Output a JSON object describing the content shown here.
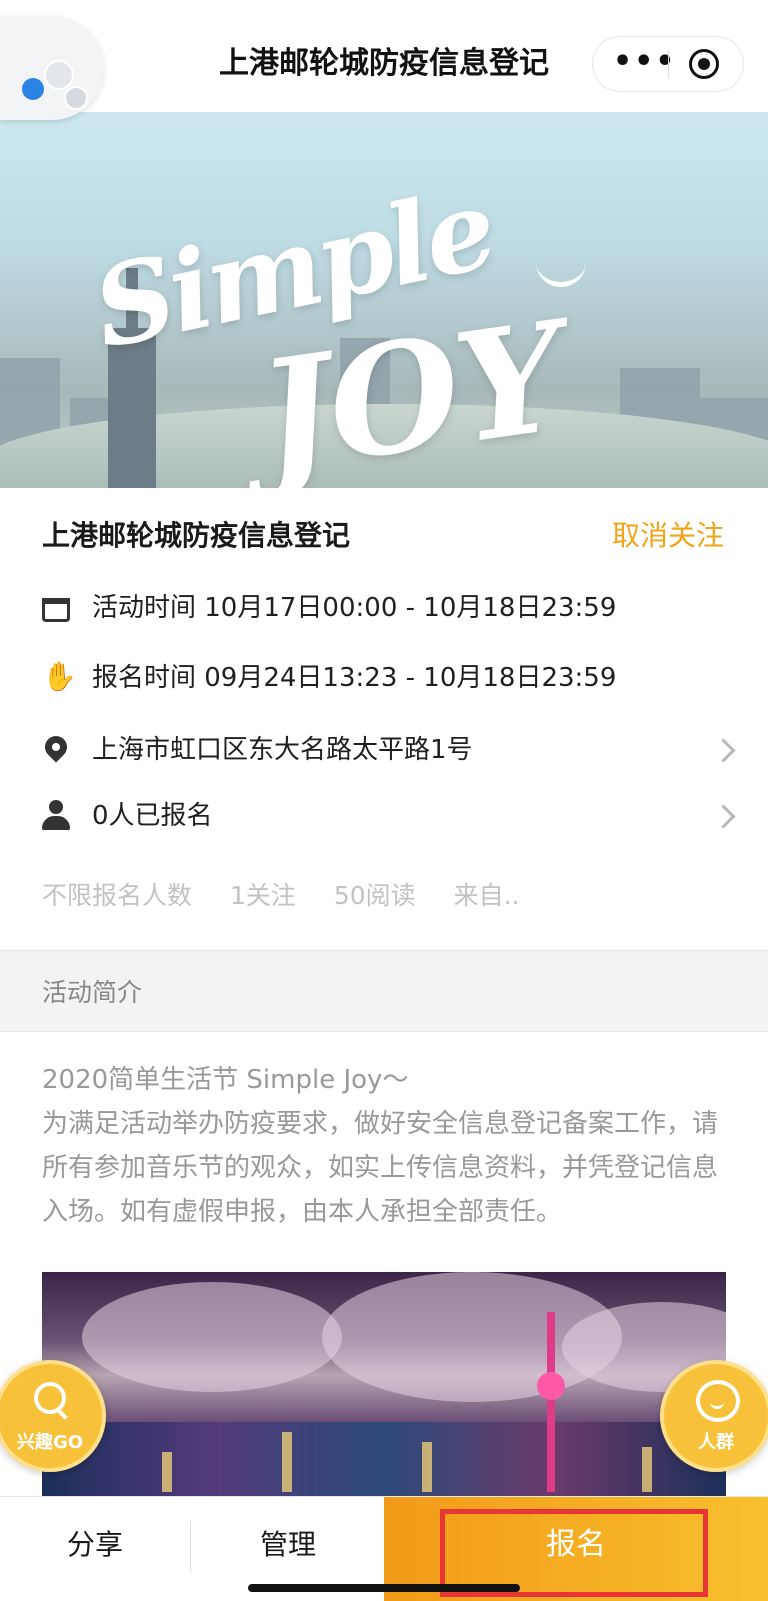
{
  "header": {
    "title": "上港邮轮城防疫信息登记",
    "more_icon": "more-dots-icon",
    "close_icon": "target-circle-icon"
  },
  "banner": {
    "art_line1": "Simple",
    "art_line2": "JOY"
  },
  "event": {
    "title": "上港邮轮城防疫信息登记",
    "follow_label": "取消关注",
    "activity_time": "活动时间 10月17日00:00 - 10月18日23:59",
    "signup_time": "报名时间 09月24日13:23 - 10月18日23:59",
    "address": "上海市虹口区东大名路太平路1号",
    "signed_up": "0人已报名",
    "stats": [
      "不限报名人数",
      "1关注",
      "50阅读",
      "来自.."
    ]
  },
  "intro": {
    "section_label": "活动简介",
    "line1": "2020简单生活节 Simple Joy～",
    "body": "为满足活动举办防疫要求，做好安全信息登记备案工作，请所有参加音乐节的观众，如实上传信息资料，并凭登记信息入场。如有虚假申报，由本人承担全部责任。"
  },
  "floating": {
    "left_label": "兴趣GO",
    "right_label": "人群"
  },
  "bottom_bar": {
    "share": "分享",
    "manage": "管理",
    "signup": "报名"
  },
  "colors": {
    "accent": "#f0a417",
    "signup_gradient_start": "#f29a18",
    "signup_gradient_end": "#f8c02e",
    "highlight_box": "#e83535"
  }
}
